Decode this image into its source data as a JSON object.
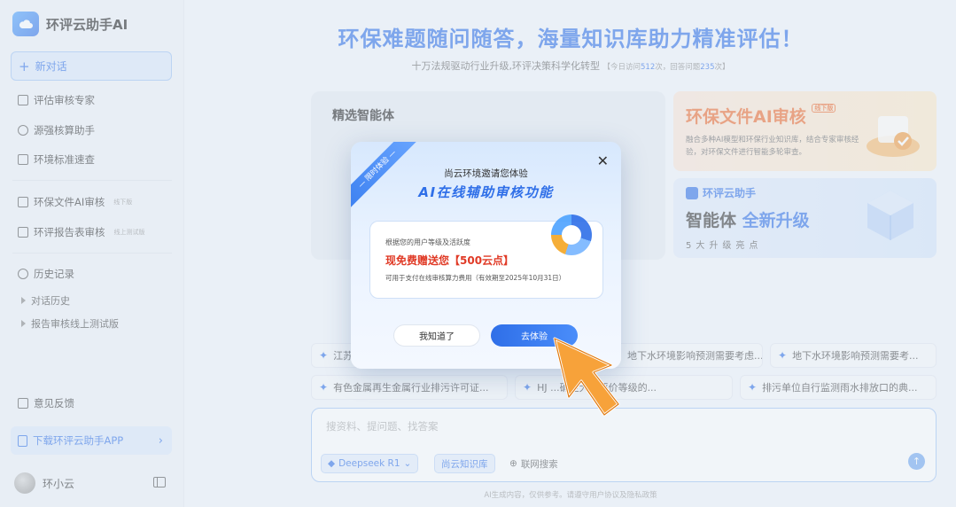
{
  "app": {
    "title": "环评云助手AI"
  },
  "sidebar": {
    "new_chat": "新对话",
    "items": [
      {
        "label": "评估审核专家"
      },
      {
        "label": "源强核算助手"
      },
      {
        "label": "环境标准速查"
      }
    ],
    "review_items": [
      {
        "label": "环保文件AI审核",
        "tag": "线下版"
      },
      {
        "label": "环评报告表审核",
        "tag": "线上测试版"
      }
    ],
    "history": {
      "label": "历史记录",
      "children": [
        {
          "label": "对话历史"
        },
        {
          "label": "报告审核线上测试版"
        }
      ]
    },
    "feedback": "意见反馈",
    "download": "下载环评云助手APP",
    "user": "环小云"
  },
  "main": {
    "hero": "环保难题随问随答，海量知识库助力精准评估！",
    "subline": "十万法规驱动行业升级,环评决策科学化转型",
    "stats": {
      "visits_prefix": "【今日访问",
      "visits": "512",
      "visits_unit": "次，回答问题",
      "answers": "235",
      "answers_unit": "次】"
    },
    "panel_title": "精选智能体",
    "card_a": {
      "title": "环保文件AI审核",
      "badge": "线下版",
      "desc": "融合多种AI模型和环保行业知识库，结合专家审核经验，对环保文件进行智能多轮审查。"
    },
    "card_b": {
      "brand": "环评云助手",
      "big_prefix": "智能体",
      "big_highlight": "全新升级",
      "small": "5大升级亮点"
    },
    "chips_row1": [
      "江苏...",
      "地下水环境影响预测需要考虑...",
      "地下水环境影响预测需要考..."
    ],
    "chips_row2": [
      "有色金属再生金属行业排污许可证...",
      "HJ ...确定大气评价等级的...",
      "排污单位自行监测雨水排放口的典..."
    ],
    "input": {
      "placeholder": "搜资料、提问题、找答案",
      "model": "Deepseek R1",
      "kb": "尚云知识库",
      "web": "联网搜索"
    },
    "footnote": "AI生成内容，仅供参考。请遵守用户协议及隐私政策"
  },
  "modal": {
    "ribbon": "— 限时体验 —",
    "top": "尚云环境邀请您体验",
    "title": "AI在线辅助审核功能",
    "line1": "根据您的用户等级及活跃度",
    "line2": "现免费赠送您【500云点】",
    "line3": "可用于支付在线审核算力费用（有效期至2025年10月31日）",
    "btn_know": "我知道了",
    "btn_go": "去体验"
  }
}
